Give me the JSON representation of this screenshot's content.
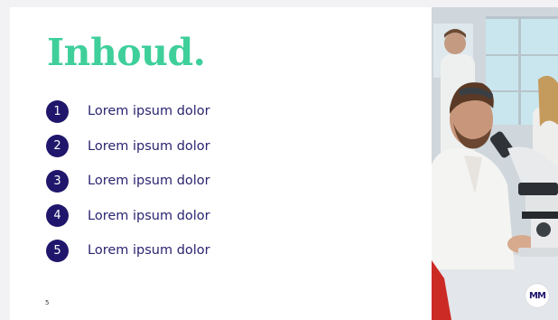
{
  "slide": {
    "title": "Inhoud.",
    "page_number": "5",
    "logo_text": "MM",
    "items": [
      {
        "number": "1",
        "label": "Lorem ipsum dolor"
      },
      {
        "number": "2",
        "label": "Lorem ipsum dolor"
      },
      {
        "number": "3",
        "label": "Lorem ipsum dolor"
      },
      {
        "number": "4",
        "label": "Lorem ipsum dolor"
      },
      {
        "number": "5",
        "label": "Lorem ipsum dolor"
      }
    ]
  },
  "colors": {
    "title": "#3ecf9b",
    "badge": "#20166b",
    "item_text": "#2a2470",
    "photo_lab_coat": "#f4f4f2",
    "photo_background": "#cfd7dc",
    "photo_window": "#c9e6ee",
    "photo_bench": "#e3e6ea",
    "photo_red_object": "#cc2a25"
  },
  "icons": {
    "logo": "mm-logo-icon",
    "photo": "scientist-with-microscope-photo"
  }
}
